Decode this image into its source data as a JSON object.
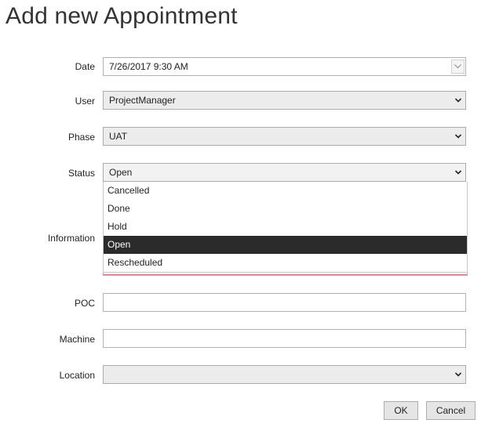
{
  "dialog": {
    "title": "Add new Appointment"
  },
  "form": {
    "date": {
      "label": "Date",
      "value": "7/26/2017 9:30 AM"
    },
    "user": {
      "label": "User",
      "value": "ProjectManager"
    },
    "phase": {
      "label": "Phase",
      "value": "UAT"
    },
    "status": {
      "label": "Status",
      "value": "Open",
      "options": [
        "Cancelled",
        "Done",
        "Hold",
        "Open",
        "Rescheduled"
      ],
      "highlighted": "Open"
    },
    "information": {
      "label": "Information",
      "value": ""
    },
    "poc": {
      "label": "POC",
      "value": ""
    },
    "machine": {
      "label": "Machine",
      "value": ""
    },
    "location": {
      "label": "Location",
      "value": ""
    }
  },
  "buttons": {
    "ok": "OK",
    "cancel": "Cancel"
  },
  "colors": {
    "dropdown_highlight": "#2b2b2b",
    "validation_error": "#e0737f",
    "combo_background": "#ececec"
  }
}
